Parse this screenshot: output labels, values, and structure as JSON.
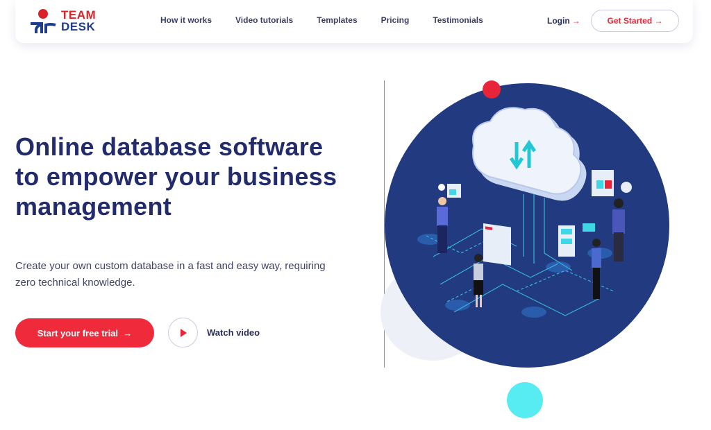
{
  "brand": {
    "name_line1": "TEAM",
    "name_line2": "DESK",
    "primary_color": "#d8232a",
    "secondary_color": "#1f3d8f"
  },
  "nav": {
    "items": [
      {
        "label": "How it works"
      },
      {
        "label": "Video tutorials"
      },
      {
        "label": "Templates"
      },
      {
        "label": "Pricing"
      },
      {
        "label": "Testimonials"
      }
    ],
    "login_label": "Login",
    "login_icon": "arrow-right-icon",
    "get_started_label": "Get Started",
    "get_started_icon": "arrow-right-icon"
  },
  "hero": {
    "title": "Online database software to empower your business management",
    "subtitle": "Create your own custom database in a fast and easy way, requiring zero technical knowledge.",
    "cta_label": "Start your free trial",
    "cta_icon": "arrow-right-icon",
    "watch_label": "Watch video",
    "play_icon": "play-icon"
  },
  "illustration": {
    "description": "Isometric cloud database illustration with people using devices",
    "cloud_icon": "cloud-sync-icon"
  },
  "colors": {
    "accent_red": "#ee2a3b",
    "heading_navy": "#222b6b",
    "circle_navy": "#213a80",
    "cyan": "#57ecf2"
  },
  "arrow": "→"
}
